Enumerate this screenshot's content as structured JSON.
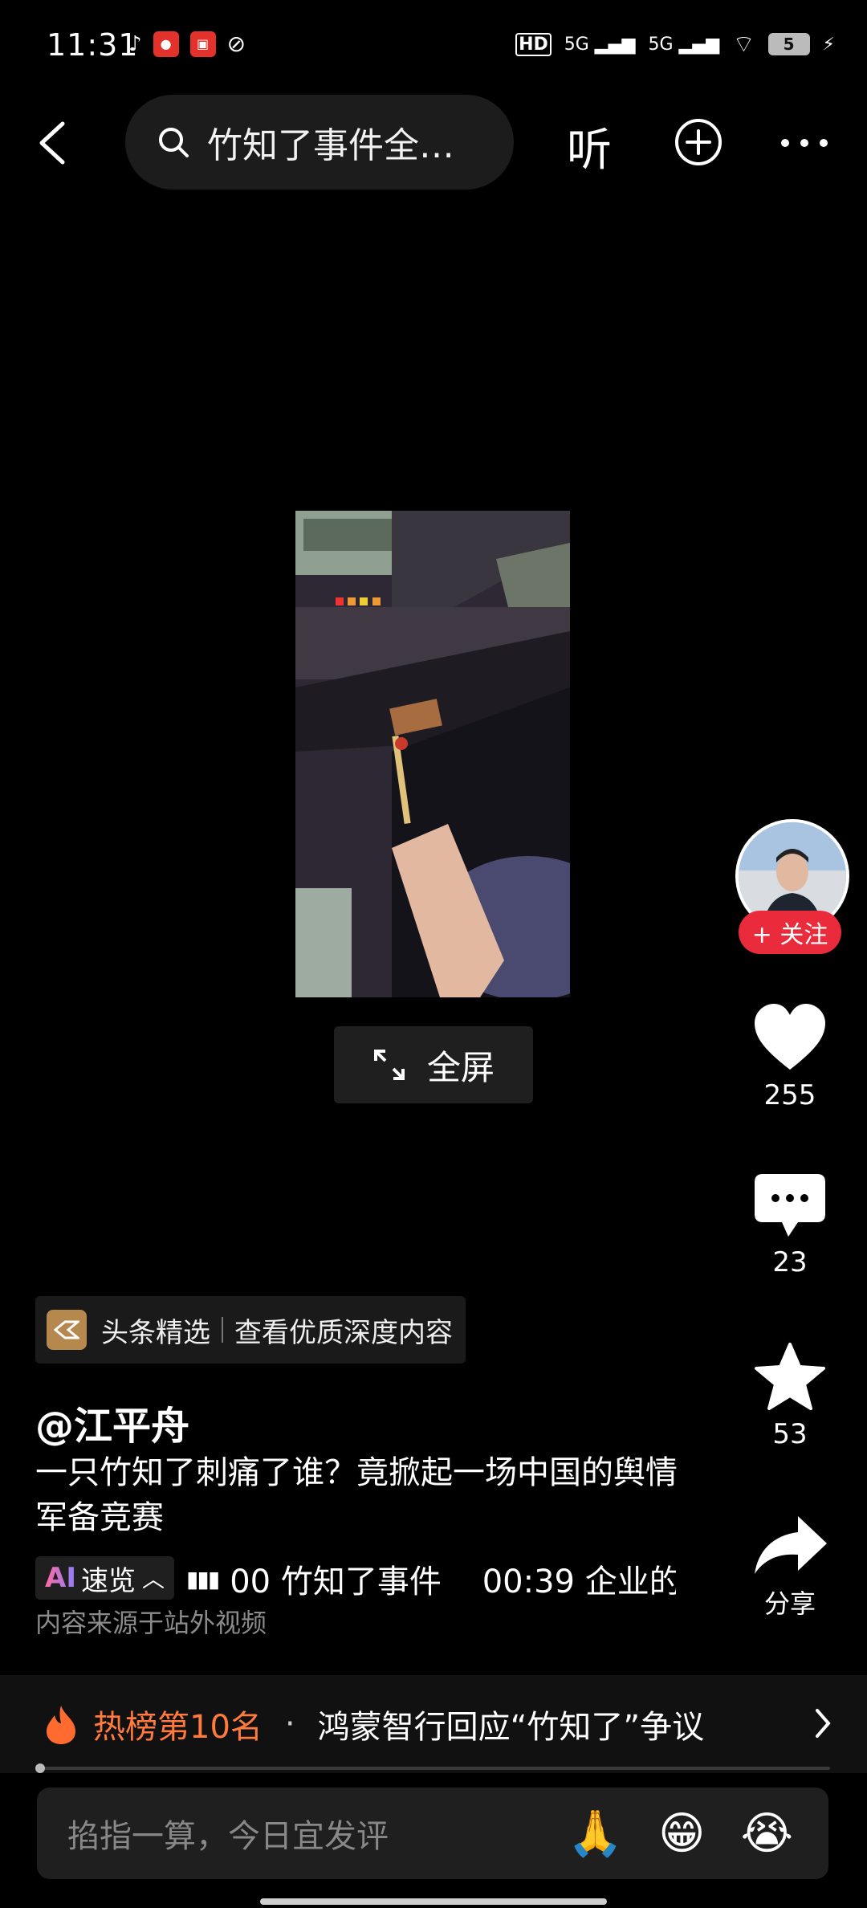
{
  "status_bar": {
    "time": "11:31",
    "network_1": "5G",
    "network_2": "5G",
    "hd": "HD",
    "battery": "5"
  },
  "top_bar": {
    "search_text": "竹知了事件全…",
    "listen_label": "听"
  },
  "video": {
    "fullscreen_label": "全屏"
  },
  "right_rail": {
    "follow_label": "+ 关注",
    "like_count": "255",
    "comment_count": "23",
    "favorite_count": "53",
    "share_label": "分享"
  },
  "content": {
    "badge_brand": "头条精选",
    "badge_text": "查看优质深度内容",
    "author": "@江平舟",
    "title": "一只竹知了刺痛了谁？竟掀起一场中国的舆情军备竞赛",
    "ai_prefix": "AI",
    "ai_label": "速览",
    "chapters_text": "00 竹知了事件    00:39 企业的",
    "source_note": "内容来源于站外视频"
  },
  "hot_list": {
    "rank_label": "热榜第10名",
    "separator": "·",
    "headline": "鸿蒙智行回应“竹知了”争议"
  },
  "comment_input": {
    "placeholder": "掐指一算，今日宜发评",
    "emoji_1": "🙏",
    "emoji_2": "😁",
    "emoji_3": "😭"
  },
  "colors": {
    "accent_red": "#ea2b3c",
    "hot_orange": "#ff7a3c"
  }
}
